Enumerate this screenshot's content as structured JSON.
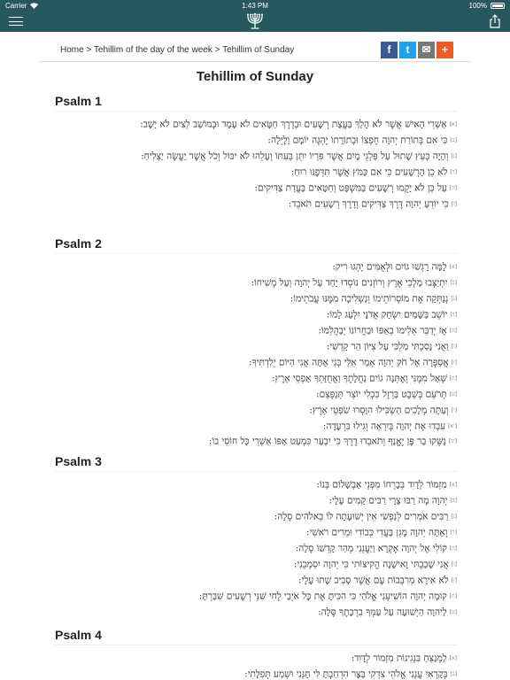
{
  "status": {
    "carrier": "Carrier",
    "time": "1:43 PM",
    "battery": "100%"
  },
  "breadcrumb": "Home > Tehillim of the day of the week > Tehillim of Sunday",
  "social": {
    "facebook": "f",
    "twitter": "t",
    "email": "✉",
    "plus": "+"
  },
  "page_title": "Tehillim of Sunday",
  "psalms": [
    {
      "heading": "Psalm 1",
      "verses": [
        {
          "n": "[א]",
          "text": "אַשְׁרֵי הָאִישׁ אֲשֶׁר לֹא הָלַךְ בַּעֲצַת רְשָׁעִים וּבְדֶרֶךְ חַטָּאִים לֹא עָמָד וּבְמוֹשַׁב לֵצִים לֹא יָשָׁב:"
        },
        {
          "n": "[ב]",
          "text": "כִּי אִם בְּתוֹרַת יְהוָה חֶפְצוֹ וּבְתוֹרָתוֹ יֶהְגֶּה יוֹמָם וָלָיְלָה:"
        },
        {
          "n": "[ג]",
          "text": "וְהָיָה כְּעֵץ שָׁתוּל עַל פַּלְגֵי מָיִם אֲשֶׁר פִּרְיוֹ יִתֵּן בְּעִתּוֹ וְעָלֵהוּ לֹא יִבּוֹל וְכֹל אֲשֶׁר יַעֲשֶׂה יַצְלִיחַ:"
        },
        {
          "n": "[ד]",
          "text": "לֹא כֵן הָרְשָׁעִים כִּי אִם כַּמֹּץ אֲשֶׁר תִּדְּפֶנּוּ רוּחַ:"
        },
        {
          "n": "[ה]",
          "text": "עַל כֵּן לֹא יָקֻמוּ רְשָׁעִים בַּמִּשְׁפָּט וְחַטָּאִים בַּעֲדַת צַדִּיקִים:"
        },
        {
          "n": "[ו]",
          "text": "כִּי יוֹדֵעַ יְהוָה דֶּרֶךְ צַדִּיקִים וְדֶרֶךְ רְשָׁעִים תֹּאבֵד:"
        }
      ]
    },
    {
      "heading": "Psalm 2",
      "verses": [
        {
          "n": "[א]",
          "text": "לָמָּה רָגְשׁוּ גוֹיִם וּלְאֻמִּים יֶהְגּוּ רִיק:"
        },
        {
          "n": "[ב]",
          "text": "יִתְיַצְּבוּ מַלְכֵי אֶרֶץ וְרוֹזְנִים נוֹסְדוּ יָחַד עַל יְהוָה וְעַל מְשִׁיחוֹ:"
        },
        {
          "n": "[ג]",
          "text": "נְנַתְּקָה אֶת מוֹסְרוֹתֵימוֹ וְנַשְׁלִיכָה מִמֶּנּוּ עֲבֹתֵימוֹ:"
        },
        {
          "n": "[ד]",
          "text": "יוֹשֵׁב בַּשָּׁמַיִם יִשְׂחָק אֲדֹנָי יִלְעַג לָמוֹ:"
        },
        {
          "n": "[ה]",
          "text": "אָז יְדַבֵּר אֵלֵימוֹ בְאַפּוֹ וּבַחֲרוֹנוֹ יְבַהֲלֵמוֹ:"
        },
        {
          "n": "[ו]",
          "text": "וַאֲנִי נָסַכְתִּי מַלְכִּי עַל צִיּוֹן הַר קָדְשִׁי:"
        },
        {
          "n": "[ז]",
          "text": "אֲסַפְּרָה אֶל חֹק יְהוָה אָמַר אֵלַי בְּנִי אַתָּה אֲנִי הַיּוֹם יְלִדְתִּיךָ:"
        },
        {
          "n": "[ח]",
          "text": "שְׁאַל מִמֶּנִּי וְאֶתְּנָה גוֹיִם נַחֲלָתֶךָ וַאֲחֻזָּתְךָ אַפְסֵי אָרֶץ:"
        },
        {
          "n": "[ט]",
          "text": "תְּרֹעֵם בְּשֵׁבֶט בַּרְזֶל כִּכְלִי יוֹצֵר תְּנַפְּצֵם:"
        },
        {
          "n": "[י]",
          "text": "וְעַתָּה מְלָכִים הַשְׂכִּילוּ הִוָּסְרוּ שֹׁפְטֵי אָרֶץ:"
        },
        {
          "n": "[יא]",
          "text": "עִבְדוּ אֶת יְהוָה בְּיִרְאָה וְגִילוּ בִּרְעָדָה:"
        },
        {
          "n": "[יב]",
          "text": "נַשְּׁקוּ בַר פֶּן יֶאֱנַף וְתֹאבְדוּ דֶרֶךְ כִּי יִבְעַר כִּמְעַט אַפּוֹ אַשְׁרֵי כָּל חוֹסֵי בוֹ:"
        }
      ]
    },
    {
      "heading": "Psalm 3",
      "verses": [
        {
          "n": "[א]",
          "text": "מִזְמוֹר לְדָוִד בְּבָרְחוֹ מִפְּנֵי אַבְשָׁלוֹם בְּנוֹ:"
        },
        {
          "n": "[ב]",
          "text": "יְהוָה מָה רַבּוּ צָרָי רַבִּים קָמִים עָלָי:"
        },
        {
          "n": "[ג]",
          "text": "רַבִּים אֹמְרִים לְנַפְשִׁי אֵין יְשׁוּעָתָה לּוֹ בֵאלֹהִים סֶלָה:"
        },
        {
          "n": "[ד]",
          "text": "וְאַתָּה יְהוָה מָגֵן בַּעֲדִי כְּבוֹדִי וּמֵרִים רֹאשִׁי:"
        },
        {
          "n": "[ה]",
          "text": "קוֹלִי אֶל יְהוָה אֶקְרָא וַיַּעֲנֵנִי מֵהַר קָדְשׁוֹ סֶלָה:"
        },
        {
          "n": "[ו]",
          "text": "אֲנִי שָׁכַבְתִּי וָאִישָׁנָה הֱקִיצוֹתִי כִּי יְהוָה יִסְמְכֵנִי:"
        },
        {
          "n": "[ז]",
          "text": "לֹא אִירָא מֵרִבְבוֹת עָם אֲשֶׁר סָבִיב שָׁתוּ עָלָי:"
        },
        {
          "n": "[ח]",
          "text": "קוּמָה יְהוָה הוֹשִׁיעֵנִי אֱלֹהַי כִּי הִכִּיתָ אֶת כָּל אֹיְבַי לֶחִי שִׁנֵּי רְשָׁעִים שִׁבַּרְתָּ:"
        },
        {
          "n": "[ט]",
          "text": "לַיהוָה הַיְשׁוּעָה עַל עַמְּךָ בִרְכָתֶךָ סֶּלָה:"
        }
      ]
    },
    {
      "heading": "Psalm 4",
      "verses": [
        {
          "n": "[א]",
          "text": "לַמְנַצֵּחַ בִּנְגִינוֹת מִזְמוֹר לְדָוִד:"
        },
        {
          "n": "[ב]",
          "text": "בְּקָרְאִי עֲנֵנִי אֱלֹהֵי צִדְקִי בַּצָּר הִרְחַבְתָּ לִּי חָנֵּנִי וּשְׁמַע תְּפִלָּתִי:"
        }
      ]
    }
  ]
}
